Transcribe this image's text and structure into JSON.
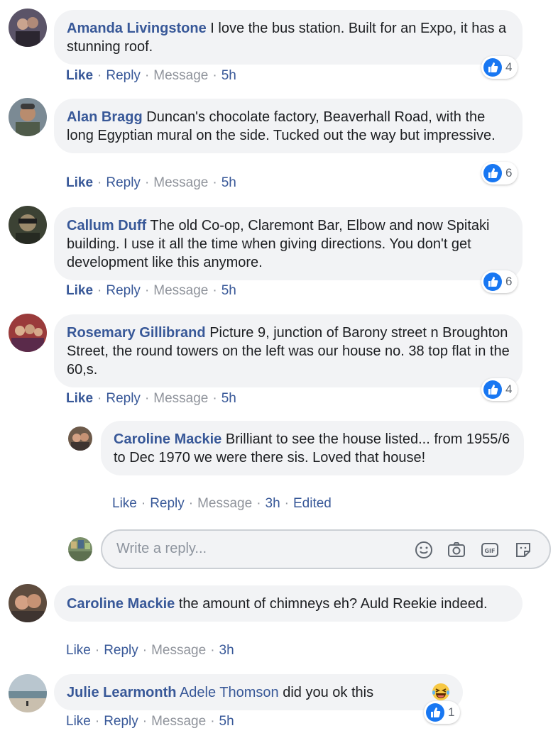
{
  "colors": {
    "link": "#385898",
    "meta": "#90949c",
    "bubble": "#f2f3f5",
    "like": "#1877f2"
  },
  "comments": [
    {
      "author": "Amanda Livingstone",
      "text": "I love the bus station. Built for an Expo, it has a stunning roof.",
      "like": "Like",
      "reply": "Reply",
      "message": "Message",
      "time": "5h",
      "reactions": "4"
    },
    {
      "author": "Alan Bragg",
      "text": "Duncan's chocolate factory, Beaverhall Road, with the long Egyptian mural on the side. Tucked out the way but impressive.",
      "like": "Like",
      "reply": "Reply",
      "message": "Message",
      "time": "5h",
      "reactions": "6"
    },
    {
      "author": "Callum Duff",
      "text": "The old Co-op, Claremont Bar, Elbow and now Spitaki building. I use it all the time when giving directions. You don't get development like this anymore.",
      "like": "Like",
      "reply": "Reply",
      "message": "Message",
      "time": "5h",
      "reactions": "6"
    },
    {
      "author": "Rosemary Gillibrand",
      "text": "Picture 9, junction of Barony street n Broughton Street, the round towers on the left was our house no. 38 top flat in the 60,s.",
      "like": "Like",
      "reply": "Reply",
      "message": "Message",
      "time": "5h",
      "reactions": "4"
    },
    {
      "author": "Caroline Mackie",
      "text": "Brilliant to see the house listed... from 1955/6 to Dec 1970 we were there sis. Loved that house!",
      "like": "Like",
      "reply": "Reply",
      "message": "Message",
      "time": "3h",
      "edited": "Edited"
    },
    {
      "author": "Caroline Mackie",
      "text": "the amount of chimneys eh? Auld Reekie indeed.",
      "like": "Like",
      "reply": "Reply",
      "message": "Message",
      "time": "3h"
    },
    {
      "author": "Julie Learmonth",
      "mention": "Adele Thomson",
      "text": "did you ok this",
      "like": "Like",
      "reply": "Reply",
      "message": "Message",
      "time": "5h",
      "reactions": "1"
    }
  ],
  "reply_box": {
    "placeholder": "Write a reply...",
    "icons": [
      "emoji-icon",
      "camera-icon",
      "gif-icon",
      "sticker-icon"
    ]
  },
  "sep": "·"
}
